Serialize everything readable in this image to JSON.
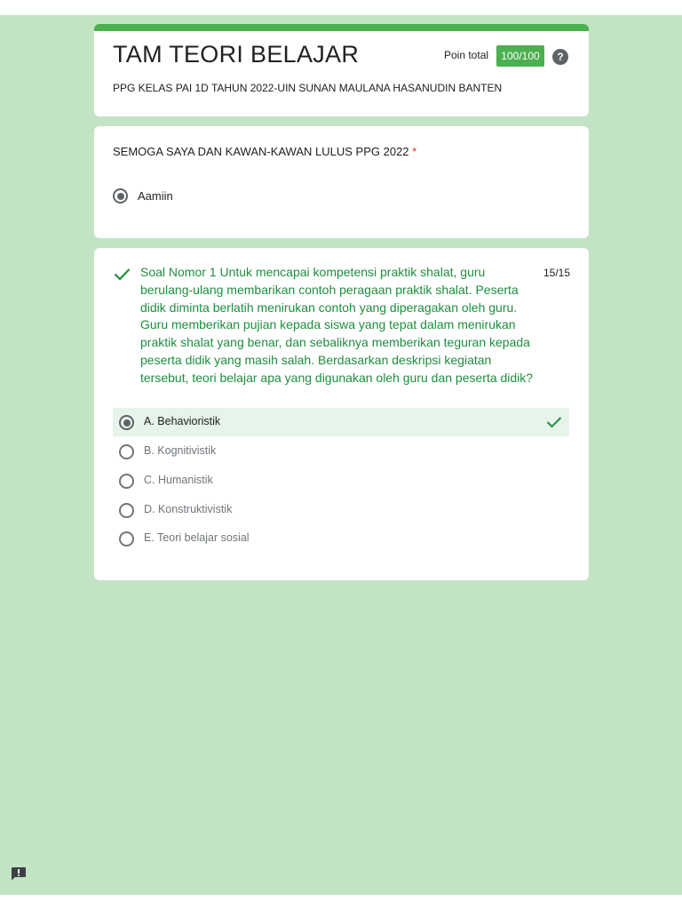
{
  "form": {
    "title": "TAM TEORI BELAJAR",
    "subtitle": "PPG KELAS PAI 1D TAHUN 2022-UIN SUNAN MAULANA HASANUDIN BANTEN",
    "points_label": "Poin total",
    "points_value": "100/100",
    "help_glyph": "?"
  },
  "question1": {
    "title": "SEMOGA SAYA DAN KAWAN-KAWAN LULUS PPG 2022",
    "required_mark": "*",
    "option": "Aamiin"
  },
  "question2": {
    "text": "Soal Nomor 1 Untuk mencapai kompetensi praktik shalat, guru berulang-ulang membarikan contoh peragaan praktik shalat. Peserta didik diminta berlatih menirukan contoh yang diperagakan oleh guru. Guru memberikan pujian kepada siswa yang tepat dalam menirukan praktik shalat yang benar, dan sebaliknya memberikan teguran kepada peserta didik yang masih salah. Berdasarkan deskripsi kegiatan tersebut, teori belajar apa yang digunakan oleh guru dan peserta didik?",
    "score": "15/15",
    "options": [
      {
        "label": "A. Behavioristik"
      },
      {
        "label": "B. Kognitivistik"
      },
      {
        "label": "C. Humanistik"
      },
      {
        "label": "D. Konstruktivistik"
      },
      {
        "label": "E. Teori belajar sosial"
      }
    ]
  },
  "icons": {
    "help": "help-icon",
    "correct": "check-icon",
    "feedback": "report-feedback-icon"
  },
  "colors": {
    "accent": "#4caf50",
    "background": "#c2e4c4",
    "correct_text": "#1e8e3e",
    "correct_row": "#e6f4ea"
  }
}
